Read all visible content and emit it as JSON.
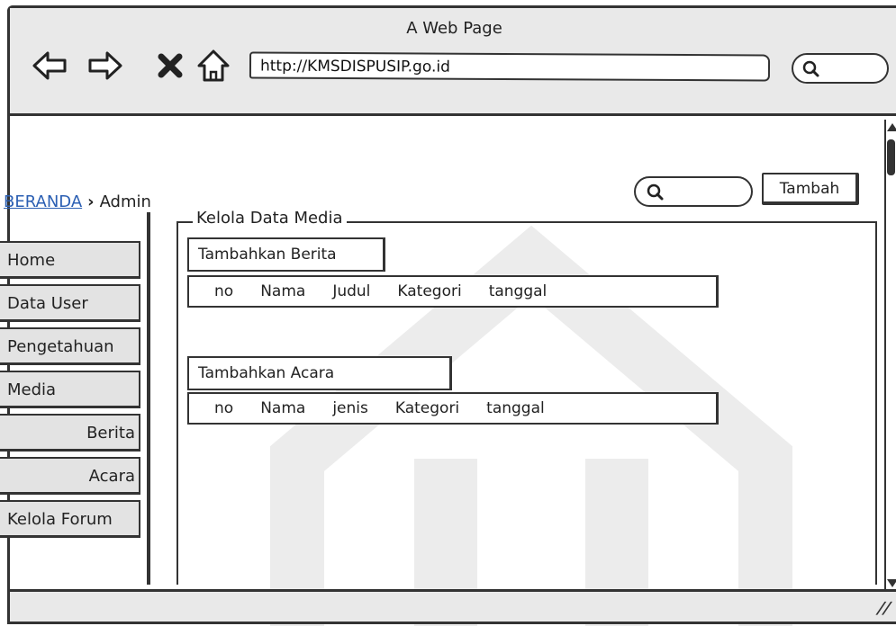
{
  "window": {
    "title": "A Web Page"
  },
  "address_bar": {
    "url": "http://KMSDISPUSIP.go.id"
  },
  "breadcrumb": {
    "home": "BERANDA",
    "current": "Admin"
  },
  "toolbar": {
    "add_label": "Tambah"
  },
  "sidebar": {
    "items": [
      {
        "label": "Home"
      },
      {
        "label": "Data User"
      },
      {
        "label": "Pengetahuan"
      },
      {
        "label": "Media"
      },
      {
        "label": "Berita"
      },
      {
        "label": "Acara"
      },
      {
        "label": "Kelola Forum"
      }
    ]
  },
  "main": {
    "group_title": "Kelola Data Media",
    "berita": {
      "add_label": "Tambahkan Berita",
      "columns": [
        "no",
        "Nama",
        "Judul",
        "Kategori",
        "tanggal"
      ]
    },
    "acara": {
      "add_label": "Tambahkan Acara",
      "columns": [
        "no",
        "Nama",
        "jenis",
        "Kategori",
        "tanggal"
      ]
    }
  },
  "icons": {
    "back": "arrow-left-icon",
    "forward": "arrow-right-icon",
    "stop": "close-icon",
    "home": "home-icon",
    "search": "search-icon",
    "resize": "resize-grip-icon"
  },
  "colors": {
    "chrome": "#e9e9e9",
    "stroke": "#333333",
    "link": "#2b5fb3",
    "menu_item": "#e3e3e3"
  }
}
